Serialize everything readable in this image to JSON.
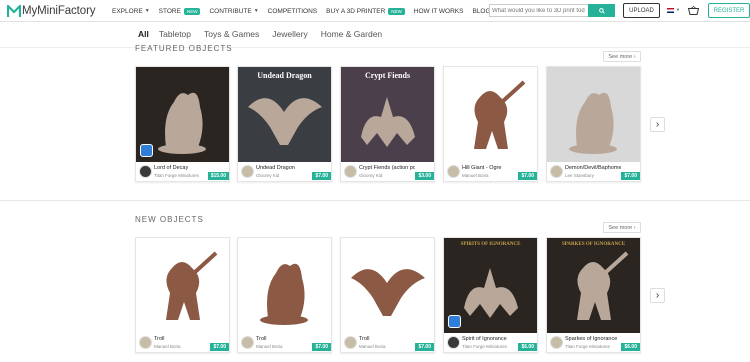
{
  "header": {
    "logo_text": "MyMiniFactory",
    "nav": [
      {
        "label": "EXPLORE",
        "caret": true,
        "badge": ""
      },
      {
        "label": "STORE",
        "caret": false,
        "badge": "NEW"
      },
      {
        "label": "CONTRIBUTE",
        "caret": true,
        "badge": ""
      },
      {
        "label": "COMPETITIONS",
        "caret": false,
        "badge": ""
      },
      {
        "label": "BUY A 3D PRINTER",
        "caret": false,
        "badge": "NEW"
      },
      {
        "label": "HOW IT WORKS",
        "caret": false,
        "badge": ""
      },
      {
        "label": "BLOG",
        "caret": false,
        "badge": ""
      }
    ],
    "search_placeholder": "What would you like to 3D print tod",
    "upload_label": "UPLOAD",
    "register_label": "REGISTER",
    "accent_color": "#25b299"
  },
  "tabs": [
    "All",
    "Tabletop",
    "Toys & Games",
    "Jewellery",
    "Home & Garden"
  ],
  "featured": {
    "title": "FEATURED OBJECTS",
    "see_more": "See more",
    "items": [
      {
        "name": "Lord of Decay",
        "author": "Titan Forge Miniatures",
        "price": "$15.00",
        "bg": "#2a2520",
        "dice": true,
        "banner": ""
      },
      {
        "name": "Undead Dragon",
        "author": "Gloomy Kid",
        "price": "$7.00",
        "bg": "#3a3d41",
        "dice": false,
        "banner": "Undead Dragon"
      },
      {
        "name": "Crypt Fiends (action poses)",
        "author": "Gloomy Kid",
        "price": "$3.00",
        "bg": "#4a3f4b",
        "dice": false,
        "banner": "Crypt Fiends"
      },
      {
        "name": "Hill Giant - Ogre",
        "author": "Manuel Boria",
        "price": "$7.00",
        "bg": "#ffffff",
        "dice": false,
        "banner": ""
      },
      {
        "name": "Demon/Devil/Baphomet Pos...",
        "author": "Lee Stansbury",
        "price": "$7.00",
        "bg": "#d8d8d8",
        "dice": false,
        "banner": ""
      }
    ]
  },
  "new_objects": {
    "title": "NEW OBJECTS",
    "see_more": "See more",
    "items": [
      {
        "name": "Troll",
        "author": "Manuel Boria",
        "price": "$7.00",
        "bg": "#ffffff",
        "dice": false,
        "banner": ""
      },
      {
        "name": "Troll",
        "author": "Manuel Boria",
        "price": "$7.00",
        "bg": "#ffffff",
        "dice": false,
        "banner": ""
      },
      {
        "name": "Troll",
        "author": "Manuel Boria",
        "price": "$7.00",
        "bg": "#ffffff",
        "dice": false,
        "banner": ""
      },
      {
        "name": "Spirit of Ignorance",
        "author": "Titan Forge Miniatures",
        "price": "$6.00",
        "bg": "#2a2520",
        "dice": true,
        "banner": "SPIRITS OF IGNORANCE"
      },
      {
        "name": "Sparkes of Ignorance",
        "author": "Titan Forge Miniatures",
        "price": "$6.00",
        "bg": "#2a2520",
        "dice": false,
        "banner": "SPARKES OF IGNORANCE"
      }
    ]
  }
}
